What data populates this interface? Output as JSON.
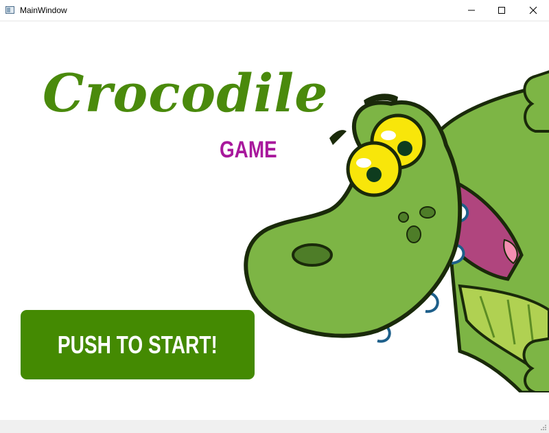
{
  "window": {
    "title": "MainWindow",
    "icon": "app-window-icon",
    "controls": [
      "minimize-icon",
      "maximize-icon",
      "close-icon"
    ]
  },
  "game": {
    "title": "Crocodile",
    "subtitle": "GAME",
    "start_label": "PUSH TO START!"
  },
  "colors": {
    "title": "#4a8a0c",
    "subtitle": "#a8189c",
    "button": "#448a02",
    "button_text": "#ffffff"
  },
  "illustration": "cartoon-crocodile-peeking"
}
